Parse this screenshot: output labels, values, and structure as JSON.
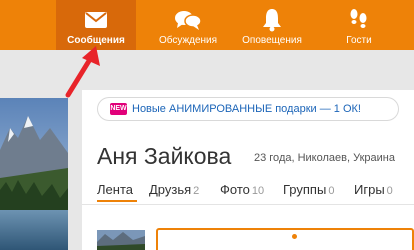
{
  "nav": {
    "items": [
      {
        "label": "Сообщения",
        "icon": "envelope-icon",
        "active": true
      },
      {
        "label": "Обсуждения",
        "icon": "speech-bubbles-icon",
        "active": false
      },
      {
        "label": "Оповещения",
        "icon": "bell-icon",
        "active": false
      },
      {
        "label": "Гости",
        "icon": "footprints-icon",
        "active": false
      }
    ]
  },
  "promo": {
    "badge": "NEW",
    "text": "Новые АНИМИРОВАННЫЕ подарки — 1 ОК!"
  },
  "profile": {
    "name": "Аня Зайкова",
    "meta": "23 года, Николаев, Украина"
  },
  "tabs": [
    {
      "label": "Лента",
      "count": ""
    },
    {
      "label": "Друзья",
      "count": "2"
    },
    {
      "label": "Фото",
      "count": "10"
    },
    {
      "label": "Группы",
      "count": "0"
    },
    {
      "label": "Игры",
      "count": "0"
    },
    {
      "label": "",
      "count": ""
    }
  ],
  "colors": {
    "accent": "#ee8208",
    "accent_dark": "#d8690a",
    "link": "#1c65b8",
    "badge": "#e1007a",
    "arrow": "#e8242a"
  }
}
